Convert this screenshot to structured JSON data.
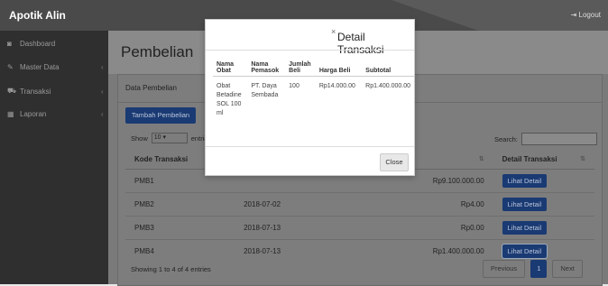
{
  "app": {
    "title": "Apotik Alin",
    "logout": "Logout"
  },
  "sidebar": {
    "items": [
      {
        "label": "Dashboard",
        "icon": "dashboard-icon",
        "glyph": "◙"
      },
      {
        "label": "Master Data",
        "icon": "wrench-icon",
        "glyph": "✎"
      },
      {
        "label": "Transaksi",
        "icon": "cart-icon",
        "glyph": "⛟"
      },
      {
        "label": "Laporan",
        "icon": "report-icon",
        "glyph": "▦"
      }
    ]
  },
  "page": {
    "title": "Pembelian",
    "panel_title": "Data Pembelian",
    "add_button": "Tambah Pembelian",
    "show_label": "Show",
    "entries_value": "10",
    "entries_label": "entries",
    "search_label": "Search:",
    "showing_text": "Showing 1 to 4 of 4 entries",
    "pager": {
      "prev": "Previous",
      "page": "1",
      "next": "Next"
    }
  },
  "table": {
    "headers": {
      "kode": "Kode Transaksi",
      "detail": "Detail Transaksi"
    },
    "rows": [
      {
        "kode": "PMB1",
        "tanggal": "",
        "total": "Rp9.100.000.00",
        "action": "Lihat Detail"
      },
      {
        "kode": "PMB2",
        "tanggal": "2018-07-02",
        "total": "Rp4.00",
        "action": "Lihat Detail"
      },
      {
        "kode": "PMB3",
        "tanggal": "2018-07-13",
        "total": "Rp0.00",
        "action": "Lihat Detail"
      },
      {
        "kode": "PMB4",
        "tanggal": "2018-07-13",
        "total": "Rp1.400.000.00",
        "action": "Lihat Detail"
      }
    ]
  },
  "modal": {
    "title": "Detail Transaksi",
    "close_x": "×",
    "headers": {
      "nama_obat": "Nama Obat",
      "nama_pemasok": "Nama Pemasok",
      "jumlah_beli": "Jumlah Beli",
      "harga_beli": "Harga Beli",
      "subtotal": "Subtotal"
    },
    "row": {
      "nama_obat": "Obat Betadine SOL 100 ml",
      "nama_pemasok": "PT. Daya Sembada",
      "jumlah_beli": "100",
      "harga_beli": "Rp14.000.00",
      "subtotal": "Rp1.400.000.00"
    },
    "close_button": "Close"
  },
  "colors": {
    "primary": "#1a3a73",
    "topbar": "#4a4a4a",
    "sidebar": "#2f2f2f"
  }
}
